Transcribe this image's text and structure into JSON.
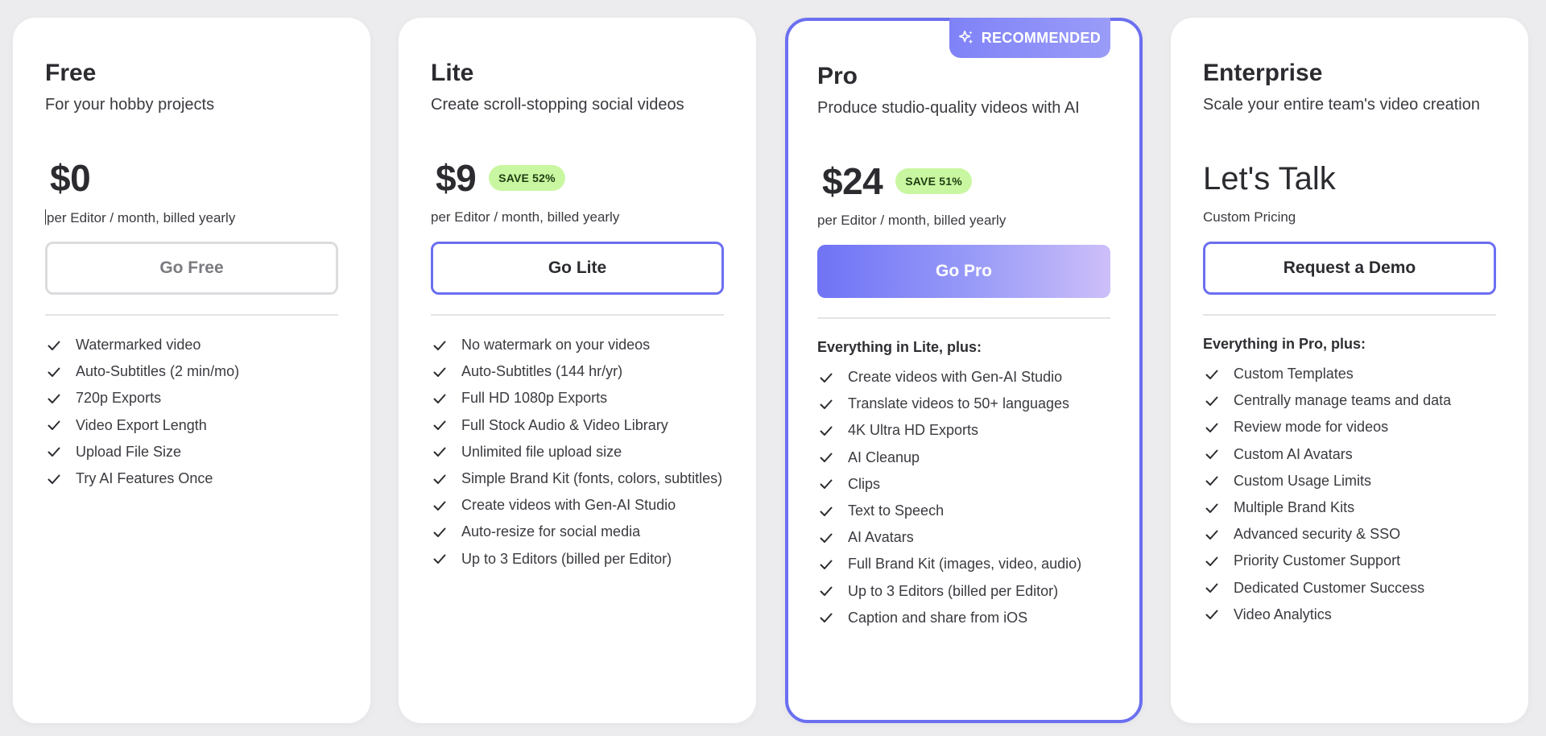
{
  "plans": [
    {
      "name": "Free",
      "tagline": "For your hobby projects",
      "price": "$0",
      "save": "",
      "billing": "per Editor / month, billed yearly",
      "cta": "Go Free",
      "features_heading": "",
      "features": [
        "Watermarked video",
        "Auto-Subtitles (2 min/mo)",
        "720p Exports",
        "Video Export Length",
        "Upload File Size",
        "Try AI Features Once"
      ]
    },
    {
      "name": "Lite",
      "tagline": "Create scroll-stopping social videos",
      "price": "$9",
      "save": "SAVE 52%",
      "billing": "per Editor / month, billed yearly",
      "cta": "Go Lite",
      "features_heading": "",
      "features": [
        "No watermark on your videos",
        "Auto-Subtitles (144 hr/yr)",
        "Full HD 1080p Exports",
        "Full Stock Audio & Video Library",
        "Unlimited file upload size",
        "Simple Brand Kit (fonts, colors, subtitles)",
        "Create videos with Gen-AI Studio",
        "Auto-resize for social media",
        "Up to 3 Editors (billed per Editor)"
      ]
    },
    {
      "name": "Pro",
      "badge": "RECOMMENDED",
      "tagline": "Produce studio-quality videos with AI",
      "price": "$24",
      "save": "SAVE 51%",
      "billing": "per Editor / month, billed yearly",
      "cta": "Go Pro",
      "features_heading": "Everything in Lite, plus:",
      "features": [
        "Create videos with Gen-AI Studio",
        "Translate videos to 50+ languages",
        "4K Ultra HD Exports",
        "AI Cleanup",
        "Clips",
        "Text to Speech",
        "AI Avatars",
        "Full Brand Kit (images, video, audio)",
        "Up to 3 Editors (billed per Editor)",
        "Caption and share from iOS"
      ]
    },
    {
      "name": "Enterprise",
      "tagline": "Scale your entire team's video creation",
      "price": "Let's Talk",
      "save": "",
      "billing": "Custom Pricing",
      "cta": "Request a Demo",
      "features_heading": "Everything in Pro, plus:",
      "features": [
        "Custom Templates",
        "Centrally manage teams and data",
        "Review mode for videos",
        "Custom AI Avatars",
        "Custom Usage Limits",
        "Multiple Brand Kits",
        "Advanced security & SSO",
        "Priority Customer Support",
        "Dedicated Customer Success",
        "Video Analytics"
      ]
    }
  ],
  "colors": {
    "accent": "#6b6ff0",
    "save_badge_bg": "#c9f7a1",
    "background": "#ececee"
  },
  "icons": {
    "feature": "check-icon",
    "badge": "sparkle-icon"
  }
}
